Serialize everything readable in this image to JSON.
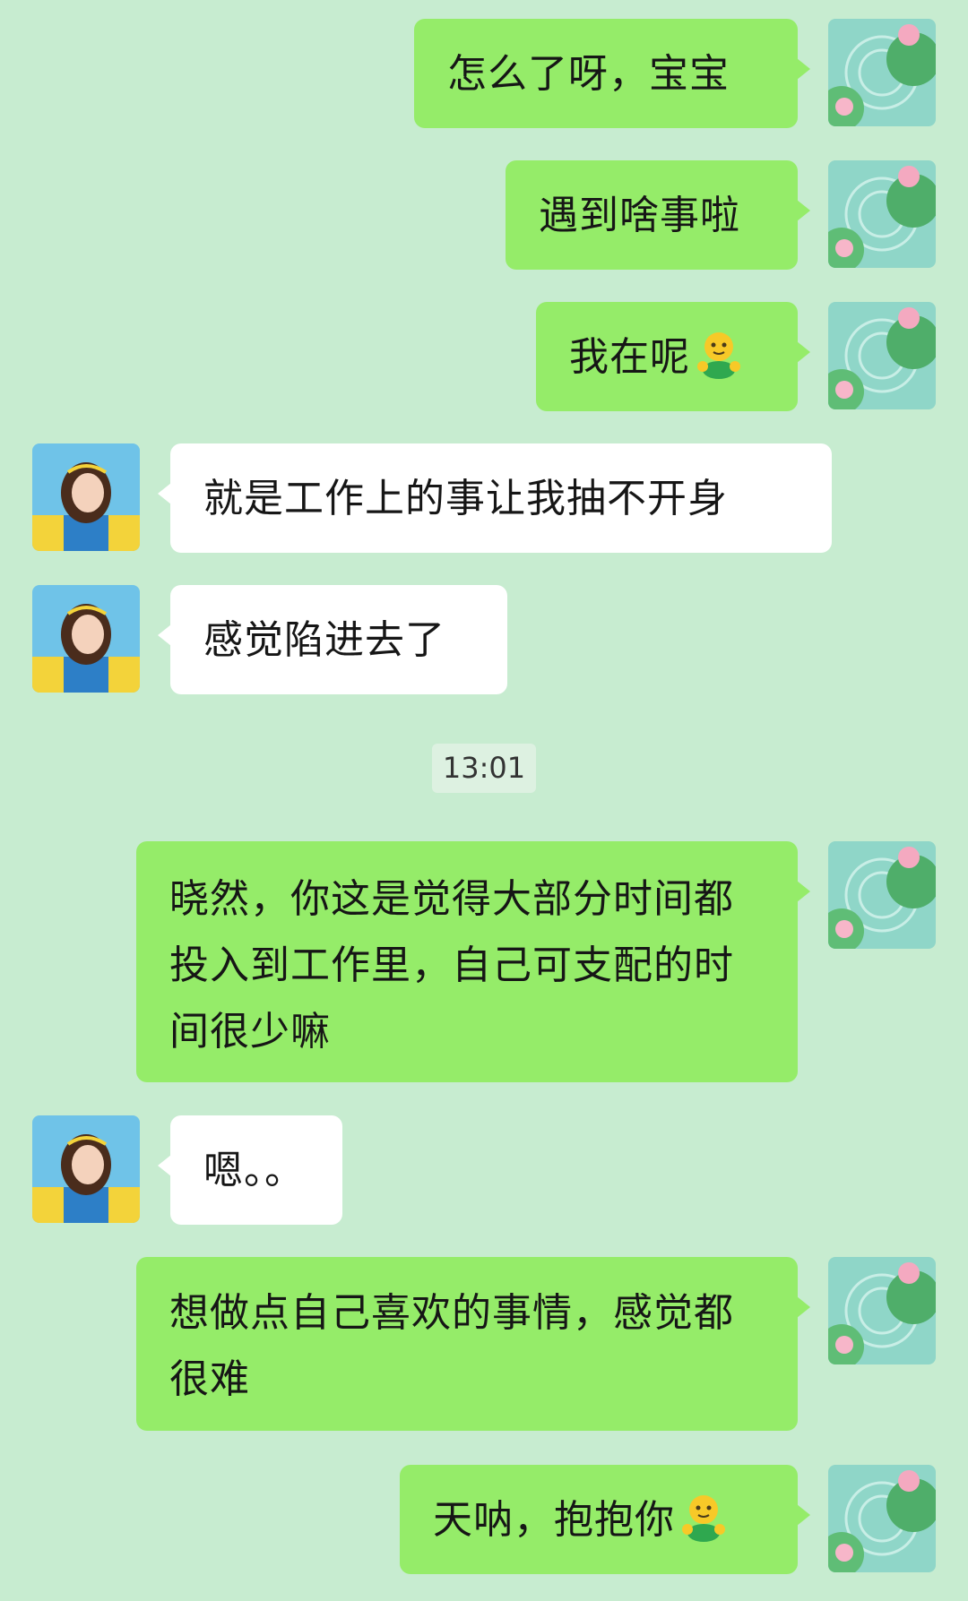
{
  "messages": [
    {
      "side": "self",
      "text": "怎么了呀，宝宝",
      "emoji": null
    },
    {
      "side": "self",
      "text": "遇到啥事啦",
      "emoji": null
    },
    {
      "side": "self",
      "text": "我在呢",
      "emoji": "hug-emoji"
    },
    {
      "side": "other",
      "text": "就是工作上的事让我抽不开身",
      "emoji": null
    },
    {
      "side": "other",
      "text": "感觉陷进去了",
      "emoji": null
    },
    {
      "side": "self",
      "text": "晓然，你这是觉得大部分时间都投入到工作里，自己可支配的时间很少嘛",
      "emoji": null
    },
    {
      "side": "other",
      "text": "嗯。。",
      "emoji": null
    },
    {
      "side": "self",
      "text": "想做点自己喜欢的事情，感觉都很难",
      "emoji": null
    },
    {
      "side": "self",
      "text": "天呐，抱抱你",
      "emoji": "hug-emoji"
    }
  ],
  "timestamp": "13:01",
  "colors": {
    "background": "#c7ecd0",
    "self_bubble": "#95ec69",
    "other_bubble": "#ffffff"
  },
  "icons": {
    "self_avatar": "lotus-pond-avatar",
    "other_avatar": "girl-portrait-avatar"
  }
}
